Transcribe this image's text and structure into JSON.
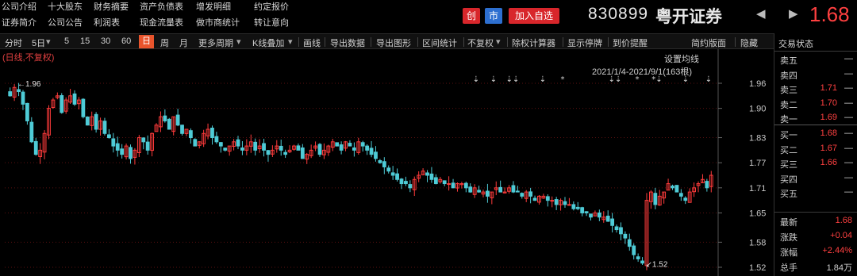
{
  "header": {
    "links_row1": [
      "公司介绍",
      "十大股东",
      "财务摘要",
      "资产负债表",
      "增发明细",
      "约定报价"
    ],
    "links_row2": [
      "证券简介",
      "公司公告",
      "利润表",
      "现金流量表",
      "做市商统计",
      "转让意向"
    ],
    "badge_chuang": "创",
    "badge_shi": "市",
    "add_watchlist": "加入自选",
    "stock_code": "830899",
    "stock_name": "粤开证券",
    "prev_arrow": "◀",
    "next_arrow": "▶",
    "last_price": "1.68"
  },
  "toolbar": {
    "items": [
      "分时",
      "5日",
      "5",
      "15",
      "30",
      "60",
      "日",
      "周",
      "月",
      "更多周期",
      "K线叠加",
      "画线",
      "导出数据",
      "导出图形",
      "区间统计",
      "不复权",
      "除权计算器",
      "显示停牌",
      "到价提醒",
      "简约版面",
      "隐藏"
    ],
    "active_index": 6,
    "dropdown_arrow": "▾"
  },
  "chart": {
    "mode_label": "(日线,不复权)",
    "ma_settings": "设置均线",
    "range_label": "2021/1/4-2021/9/1(163根)",
    "high_marker": "1.96",
    "low_marker": "1.52",
    "y_ticks": [
      "1.96",
      "1.90",
      "1.83",
      "1.77",
      "1.71",
      "1.65",
      "1.58",
      "1.52"
    ],
    "event_marks": [
      "⇣",
      "⇣",
      "⇣⇣",
      "⇣",
      "*",
      "⇣⇣",
      "*",
      "*⇣",
      "⇣",
      "⇣"
    ],
    "colors": {
      "up": "#ff3b3b",
      "down": "#4ecbd6",
      "grid": "#5a1010",
      "axis_text": "#c8c8c8",
      "flat": "#d0d0d0"
    }
  },
  "chart_data": {
    "type": "candlestick",
    "x_range": [
      "2021/1/4",
      "2021/9/1"
    ],
    "bar_count": 163,
    "ylim": [
      1.52,
      1.96
    ],
    "y_ticks": [
      1.96,
      1.9,
      1.83,
      1.77,
      1.71,
      1.65,
      1.58,
      1.52
    ],
    "annotations": [
      {
        "label": "1.96",
        "kind": "high"
      },
      {
        "label": "1.52",
        "kind": "low"
      }
    ],
    "close_estimates": [
      1.93,
      1.95,
      1.94,
      1.91,
      1.87,
      1.82,
      1.79,
      1.8,
      1.84,
      1.9,
      1.92,
      1.93,
      1.89,
      1.92,
      1.93,
      1.91,
      1.92,
      1.88,
      1.86,
      1.88,
      1.85,
      1.87,
      1.84,
      1.83,
      1.81,
      1.8,
      1.79,
      1.81,
      1.78,
      1.8,
      1.83,
      1.82,
      1.8,
      1.84,
      1.86,
      1.88,
      1.87,
      1.85,
      1.88,
      1.86,
      1.84,
      1.85,
      1.83,
      1.81,
      1.82,
      1.84,
      1.85,
      1.83,
      1.82,
      1.81,
      1.8,
      1.81,
      1.82,
      1.81,
      1.8,
      1.81,
      1.82,
      1.8,
      1.81,
      1.8,
      1.79,
      1.8,
      1.81,
      1.8,
      1.79,
      1.8,
      1.81,
      1.8,
      1.78,
      1.79,
      1.8,
      1.81,
      1.79,
      1.8,
      1.81,
      1.82,
      1.81,
      1.8,
      1.82,
      1.81,
      1.8,
      1.82,
      1.81,
      1.8,
      1.79,
      1.78,
      1.77,
      1.76,
      1.75,
      1.74,
      1.73,
      1.72,
      1.72,
      1.71,
      1.73,
      1.74,
      1.75,
      1.74,
      1.73,
      1.72,
      1.73,
      1.72,
      1.72,
      1.71,
      1.72,
      1.72,
      1.71,
      1.7,
      1.71,
      1.7,
      1.7,
      1.69,
      1.7,
      1.71,
      1.7,
      1.7,
      1.71,
      1.7,
      1.7,
      1.69,
      1.7,
      1.69,
      1.68,
      1.69,
      1.69,
      1.68,
      1.68,
      1.67,
      1.68,
      1.67,
      1.67,
      1.66,
      1.66,
      1.65,
      1.65,
      1.64,
      1.65,
      1.64,
      1.64,
      1.63,
      1.62,
      1.61,
      1.6,
      1.59,
      1.57,
      1.55,
      1.54,
      1.53,
      1.68,
      1.7,
      1.67,
      1.69,
      1.7,
      1.72,
      1.71,
      1.7,
      1.69,
      1.68,
      1.7,
      1.71,
      1.72,
      1.73,
      1.71,
      1.74
    ]
  },
  "panel": {
    "title": "交易状态",
    "asks": [
      {
        "label": "卖五",
        "price": "",
        "vol": "—"
      },
      {
        "label": "卖四",
        "price": "",
        "vol": "—"
      },
      {
        "label": "卖三",
        "price": "1.71",
        "vol": "—"
      },
      {
        "label": "卖二",
        "price": "1.70",
        "vol": "—"
      },
      {
        "label": "卖一",
        "price": "1.69",
        "vol": "—"
      }
    ],
    "bids": [
      {
        "label": "买一",
        "price": "1.68",
        "vol": "—"
      },
      {
        "label": "买二",
        "price": "1.67",
        "vol": "—"
      },
      {
        "label": "买三",
        "price": "1.66",
        "vol": "—"
      },
      {
        "label": "买四",
        "price": "",
        "vol": "—"
      },
      {
        "label": "买五",
        "price": "",
        "vol": "—"
      }
    ],
    "stats": [
      {
        "label": "最新",
        "value": "1.68"
      },
      {
        "label": "涨跌",
        "value": "+0.04"
      },
      {
        "label": "涨幅",
        "value": "+2.44%"
      },
      {
        "label": "总手",
        "value": "1.84万"
      }
    ]
  }
}
